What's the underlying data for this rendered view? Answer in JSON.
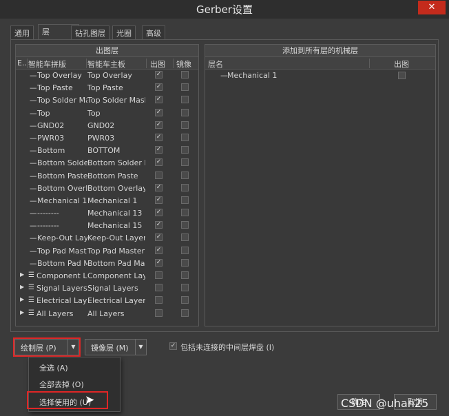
{
  "window": {
    "title": "Gerber设置",
    "close_glyph": "✕"
  },
  "tabs": [
    "通用",
    "层",
    "钻孔图层",
    "光圈",
    "高级"
  ],
  "left_panel": {
    "header": "出图层",
    "columns": [
      "E...",
      "智能车拼版",
      "智能车主板",
      "出图",
      "镜像"
    ],
    "rows": [
      {
        "prefix": "—",
        "name1": "Top Overlay",
        "name2": "Top Overlay",
        "plot": true,
        "mirror": false,
        "group": false
      },
      {
        "prefix": "—",
        "name1": "Top Paste",
        "name2": "Top Paste",
        "plot": true,
        "mirror": false,
        "group": false
      },
      {
        "prefix": "—",
        "name1": "Top Solder Ma",
        "name2": "Top Solder Mask",
        "plot": true,
        "mirror": false,
        "group": false
      },
      {
        "prefix": "—",
        "name1": "Top",
        "name2": "Top",
        "plot": true,
        "mirror": false,
        "group": false
      },
      {
        "prefix": "—",
        "name1": "GND02",
        "name2": "GND02",
        "plot": true,
        "mirror": false,
        "group": false
      },
      {
        "prefix": "—",
        "name1": " PWR03",
        "name2": "PWR03",
        "plot": true,
        "mirror": false,
        "group": false
      },
      {
        "prefix": "—",
        "name1": "Bottom",
        "name2": "BOTTOM",
        "plot": true,
        "mirror": false,
        "group": false
      },
      {
        "prefix": "—",
        "name1": "Bottom Solder",
        "name2": "Bottom Solder M",
        "plot": true,
        "mirror": false,
        "group": false
      },
      {
        "prefix": "—",
        "name1": "Bottom Paste",
        "name2": "Bottom Paste",
        "plot": false,
        "mirror": false,
        "group": false
      },
      {
        "prefix": "—",
        "name1": "Bottom Overl",
        "name2": "Bottom Overlay",
        "plot": true,
        "mirror": false,
        "group": false
      },
      {
        "prefix": "—",
        "name1": "Mechanical 1",
        "name2": "Mechanical 1",
        "plot": true,
        "mirror": false,
        "group": false
      },
      {
        "prefix": "—",
        "name1": "--------",
        "name2": "Mechanical 13",
        "plot": true,
        "mirror": false,
        "group": false
      },
      {
        "prefix": "—",
        "name1": "--------",
        "name2": "Mechanical 15",
        "plot": true,
        "mirror": false,
        "group": false
      },
      {
        "prefix": "—",
        "name1": "Keep-Out Lay",
        "name2": "Keep-Out Layer",
        "plot": true,
        "mirror": false,
        "group": false
      },
      {
        "prefix": "—",
        "name1": "Top Pad Mast",
        "name2": "Top Pad Master",
        "plot": true,
        "mirror": false,
        "group": false
      },
      {
        "prefix": "—",
        "name1": "Bottom Pad M",
        "name2": "Bottom Pad Mas",
        "plot": true,
        "mirror": false,
        "group": false
      },
      {
        "prefix": "",
        "name1": "Component L",
        "name2": "Component Laye",
        "plot": false,
        "mirror": false,
        "group": true
      },
      {
        "prefix": "",
        "name1": "Signal Layers",
        "name2": "Signal Layers",
        "plot": false,
        "mirror": false,
        "group": true
      },
      {
        "prefix": "",
        "name1": "Electrical Laye",
        "name2": "Electrical Layers",
        "plot": false,
        "mirror": false,
        "group": true
      },
      {
        "prefix": "",
        "name1": "All Layers",
        "name2": "All Layers",
        "plot": false,
        "mirror": false,
        "group": true
      }
    ]
  },
  "right_panel": {
    "header": "添加到所有层的机械层",
    "columns": [
      "层名",
      "出图"
    ],
    "rows": [
      {
        "prefix": "—",
        "name": "Mechanical 1",
        "plot": false
      }
    ]
  },
  "buttons": {
    "plot_layers": "绘制层 (P)",
    "mirror_layers": "镜像层 (M)",
    "dropdown_glyph": "▼",
    "ok": "确定",
    "cancel": "取消"
  },
  "option": {
    "label": "包括未连接的中间层焊盘 (I)",
    "checked": true
  },
  "menu": {
    "items": [
      "全选 (A)",
      "全部去掉 (O)",
      "选择使用的 (U)"
    ]
  },
  "watermark": "CSDN @uhan25",
  "icons": {
    "check_glyph": "✓",
    "expand_glyph": "▶",
    "group_glyph": "☰",
    "cursor_glyph": "➤"
  },
  "colors": {
    "highlight": "#e02626",
    "close": "#c42b1c"
  }
}
